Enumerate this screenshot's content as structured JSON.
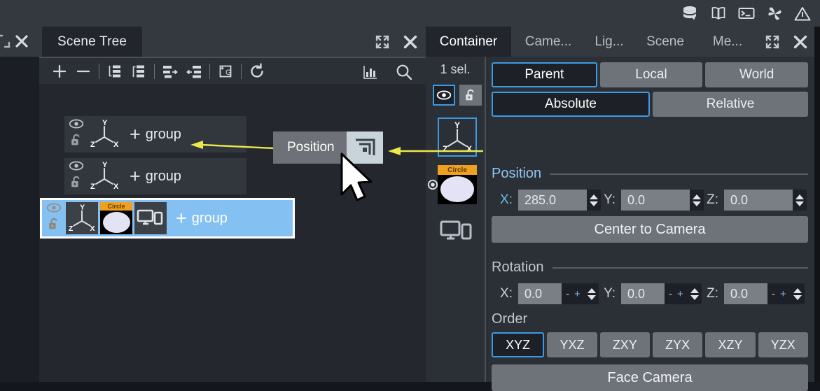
{
  "topbar": {
    "icons": [
      {
        "name": "database-icon",
        "label": "Database"
      },
      {
        "name": "book-icon",
        "label": "Documentation"
      },
      {
        "name": "terminal-icon",
        "label": "Console"
      },
      {
        "name": "pinwheel-icon",
        "label": "Plugins"
      },
      {
        "name": "warning-triangle-icon",
        "label": "Warnings"
      }
    ]
  },
  "left_sliver": {
    "expand_icon": "expand-icon",
    "close_icon": "close-icon"
  },
  "scene_panel": {
    "tab_label": "Scene Tree",
    "header_icons": [
      {
        "name": "expand-icon",
        "label": "Maximize"
      },
      {
        "name": "close-icon",
        "label": "Close"
      }
    ],
    "toolbar": [
      {
        "name": "add-node-button",
        "icon": "plus-icon",
        "label": "Add"
      },
      {
        "name": "remove-node-button",
        "icon": "minus-icon",
        "label": "Remove"
      },
      {
        "name": "move-up-button",
        "icon": "tree-up-icon",
        "label": "Move Up"
      },
      {
        "name": "move-down-button",
        "icon": "tree-down-icon",
        "label": "Move Down"
      },
      {
        "name": "unparent-button",
        "icon": "tree-out-icon",
        "label": "Unparent"
      },
      {
        "name": "parent-button",
        "icon": "tree-in-icon",
        "label": "Parent"
      },
      {
        "name": "group-button",
        "icon": "group-g-icon",
        "label": "Group"
      },
      {
        "name": "refresh-button",
        "icon": "refresh-icon",
        "label": "Refresh"
      }
    ],
    "toolbar_right": [
      {
        "name": "histogram-button",
        "icon": "histogram-icon",
        "label": "Statistics"
      },
      {
        "name": "search-button",
        "icon": "search-icon",
        "label": "Search"
      }
    ],
    "tree_rows": [
      {
        "name": "group",
        "plus": "+",
        "selected": false,
        "thumbs": [
          "axis"
        ],
        "visible_icon": "eye-icon",
        "lock_icon": "unlock-icon"
      },
      {
        "name": "group",
        "plus": "+",
        "selected": false,
        "thumbs": [
          "axis"
        ],
        "visible_icon": "eye-icon",
        "lock_icon": "unlock-icon"
      },
      {
        "name": "group",
        "plus": "+",
        "selected": true,
        "thumbs": [
          "axis",
          "circle",
          "display"
        ],
        "visible_icon": "eye-icon",
        "lock_icon": "unlock-icon",
        "circle_label": "Circle"
      }
    ]
  },
  "callout": {
    "text": "Position",
    "icon": "nested-squares-icon"
  },
  "properties": {
    "tabs": [
      {
        "label": "Container",
        "active": true
      },
      {
        "label": "Came...",
        "active": false
      },
      {
        "label": "Lig...",
        "active": false
      },
      {
        "label": "Scene",
        "active": false
      },
      {
        "label": "Me...",
        "active": false
      }
    ],
    "header_icons": [
      {
        "name": "expand-icon",
        "label": "Maximize"
      },
      {
        "name": "close-icon",
        "label": "Close"
      }
    ],
    "selection_count": "1 sel.",
    "toggles": [
      {
        "name": "visibility-toggle",
        "icon": "eye-icon",
        "active": true
      },
      {
        "name": "lock-toggle",
        "icon": "unlock-icon",
        "active": false
      }
    ],
    "minis": [
      {
        "name": "axis-gizmo-thumb",
        "active": true
      },
      {
        "name": "circle-thumb",
        "label": "Circle",
        "active": false
      },
      {
        "name": "display-thumb",
        "active": false
      }
    ],
    "space_segments": [
      {
        "label": "Parent",
        "active": true
      },
      {
        "label": "Local",
        "active": false
      },
      {
        "label": "World",
        "active": false
      }
    ],
    "mode_segments": [
      {
        "label": "Absolute",
        "active": true
      },
      {
        "label": "Relative",
        "active": false
      }
    ],
    "position": {
      "title": "Position",
      "x_label": "X:",
      "x_value": "285.0",
      "y_label": "Y:",
      "y_value": "0.0",
      "z_label": "Z:",
      "z_value": "0.0",
      "button": "Center to Camera"
    },
    "rotation": {
      "title": "Rotation",
      "x_label": "X:",
      "x_value": "0.0",
      "y_label": "Y:",
      "y_value": "0.0",
      "z_label": "Z:",
      "z_value": "0.0",
      "minus": "-",
      "plus": "+"
    },
    "order": {
      "title": "Order",
      "options": [
        {
          "label": "XYZ",
          "active": true
        },
        {
          "label": "YXZ",
          "active": false
        },
        {
          "label": "ZXY",
          "active": false
        },
        {
          "label": "ZYX",
          "active": false
        },
        {
          "label": "XZY",
          "active": false
        },
        {
          "label": "YZX",
          "active": false
        }
      ],
      "button": "Face Camera"
    }
  },
  "colors": {
    "accent_blue": "#3d9ae0",
    "selection_blue": "#84c1f2",
    "panel_bg": "#2b2f36",
    "header_bg": "#34383f",
    "tree_bg": "#24272d",
    "button_gray": "#6e7279",
    "field_gray": "#7a7e85",
    "callout_yellow": "#eae84a",
    "orange_badge": "#f0a020"
  }
}
